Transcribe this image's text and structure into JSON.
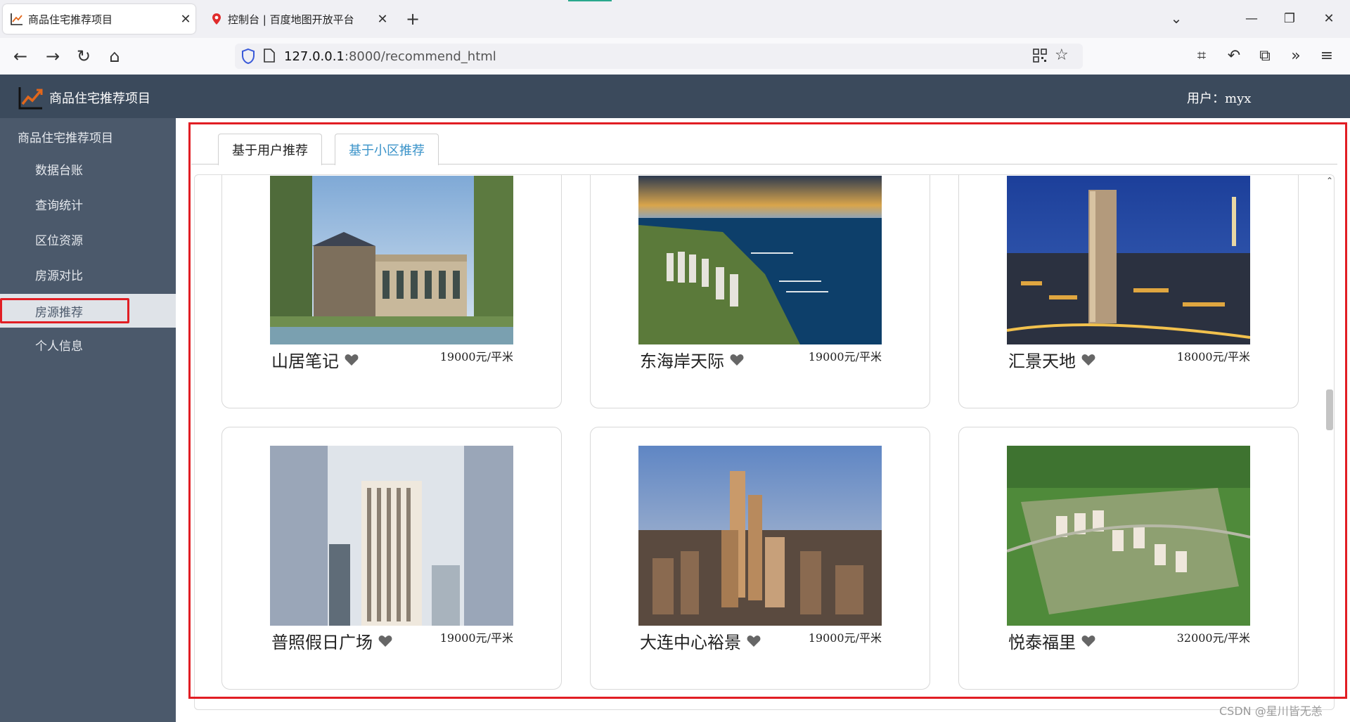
{
  "browser": {
    "tabs": [
      {
        "title": "商品住宅推荐项目",
        "active": true
      },
      {
        "title": "控制台 | 百度地图开放平台",
        "active": false
      }
    ],
    "url_host": "127.0.0.1",
    "url_path": ":8000/recommend_html"
  },
  "app": {
    "brand": "商品住宅推荐项目",
    "user_label": "用户：myx"
  },
  "sidebar": {
    "title": "商品住宅推荐项目",
    "items": [
      {
        "label": "数据台账"
      },
      {
        "label": "查询统计"
      },
      {
        "label": "区位资源"
      },
      {
        "label": "房源对比"
      },
      {
        "label": "房源推荐",
        "active": true
      },
      {
        "label": "个人信息"
      }
    ]
  },
  "content": {
    "tabs": [
      {
        "label": "基于用户推荐"
      },
      {
        "label": "基于小区推荐",
        "active": true
      }
    ],
    "cards": [
      {
        "name": "山居笔记",
        "price": "19000元/平米"
      },
      {
        "name": "东海岸天际",
        "price": "19000元/平米"
      },
      {
        "name": "汇景天地",
        "price": "18000元/平米"
      },
      {
        "name": "普照假日广场",
        "price": "19000元/平米"
      },
      {
        "name": "大连中心裕景",
        "price": "19000元/平米"
      },
      {
        "name": "悦泰福里",
        "price": "32000元/平米"
      }
    ]
  },
  "watermark": "CSDN @星川皆无恙",
  "colors": {
    "header_bg": "#3b4a5c",
    "sidebar_bg": "#4b596b",
    "highlight_red": "#e11e24",
    "active_tab_text": "#3a93c9"
  }
}
